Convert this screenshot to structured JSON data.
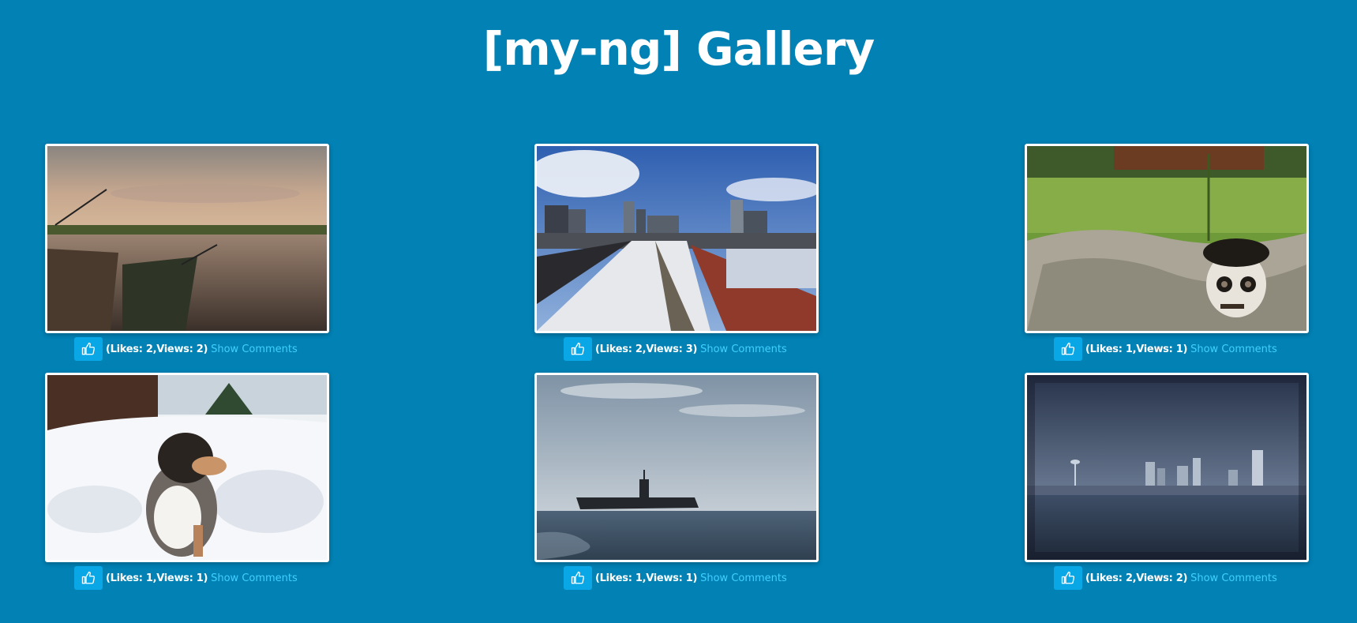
{
  "page": {
    "title": "[my-ng] Gallery"
  },
  "photos": [
    {
      "subject": "lake at dusk with fishing rods",
      "likes_text": "(Likes: 2,Views: 2)",
      "link": "Show Comments"
    },
    {
      "subject": "city skyline from snowy bridge",
      "likes_text": "(Likes: 2,Views: 3)",
      "link": "Show Comments"
    },
    {
      "subject": "creature figure on rock in grass",
      "likes_text": "(Likes: 1,Views: 1)",
      "link": "Show Comments"
    },
    {
      "subject": "dog sitting in snow",
      "likes_text": "(Likes: 1,Views: 1)",
      "link": "Show Comments"
    },
    {
      "subject": "aircraft carrier at sea",
      "likes_text": "(Likes: 1,Views: 1)",
      "link": "Show Comments"
    },
    {
      "subject": "city skyline across water",
      "likes_text": "(Likes: 2,Views: 2)",
      "link": "Show Comments"
    }
  ],
  "icons": {
    "like": "thumbs-up-icon"
  },
  "colors": {
    "background": "#0281b4",
    "button": "#0aa7e6",
    "link": "#3fd0ff"
  }
}
